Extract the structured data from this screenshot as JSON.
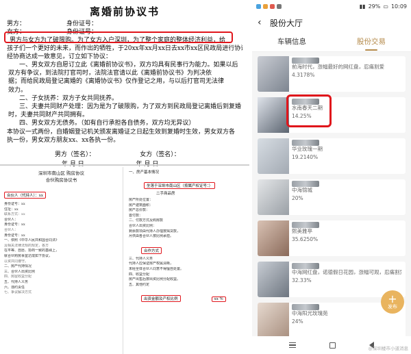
{
  "doc": {
    "title": "离婚前协议书",
    "male_label": "男方：",
    "id_label": "身份证号：",
    "female_label": "女方：",
    "intro_highlight": "男方与女方为了破限购。为了女方入户深圳，为了整个家庭的整体经济利益，",
    "intro_tail": "给",
    "intro_line2": "孩子们一个更好的未来，而作出的牺牲，于20xx年xx月xx日去xx市xx区民政局进行协议离婚，",
    "intro_line3": "经协商达成一致意见，订立如下协议：",
    "clauses": [
      "一、男女双方自愿订立此《离婚前协议书》，双方均具有民事行为能力。如果以后",
      "双方有争议，到法院打官司时，法院法官请以此《离婚前协议书》为判决依",
      "据；而给民政局登记离婚的《离婚协议书》仅作登记之用，与以后打官司无法律",
      "效力。",
      "二、子女抚养：双方子女共同抚养。",
      "三、夫妻共同财产处理：因为是为了破限购，为了双方到民政局登记离婚后到复婚",
      "时，夫妻共同财产共同拥有。",
      "四、男女双方无债务。（如有自行承担各自债务，双方均无异议）",
      "本协议一式两份，自婚姻登记机关颁发离婚证之日起生效到复婚时生效，男女双方各",
      "执一份，男女双方朋友xx、xx各执一份。"
    ],
    "sign_male": "男方（签名）：",
    "sign_female": "女方（签名）：",
    "date_text": "年    月    日"
  },
  "contract_a": {
    "header": "深圳市南山区    购房协议",
    "sub": "合伙购房协议书",
    "tag": "合伙人（代持人）：xx",
    "lines": [
      "身份证号：xx",
      "住址：xx",
      "联系方式：xx",
      "合伙人：",
      "身份证号：xx",
      "合伙人：",
      "身份证号：xx",
      "一、依照《中华人民共和国合同法》",
      "及相关法律法规的规定，各方",
      "在平等、自愿、协商一致的基础上，",
      "就合伙购房事宜达成如下协议，",
      "以资共同遵守。",
      "二、房产代持情况",
      "三、合伙人出资比例",
      "四、房屋收益分配",
      "五、代持人义务",
      "六、违约责任",
      "七、争议解决方式"
    ]
  },
  "contract_b": {
    "label_1": "一、房产基本情况",
    "tag_1": "坐落于深圳市南山区（按属产权证号：）",
    "tag_1b": "二手商品房",
    "tag_2": "合作方式",
    "tag_3": "出资金额及产权比例",
    "tag_4": "xx %",
    "lines": [
      "房产所处位置：",
      "房产建筑面积：",
      "房产总价款：",
      "首付款：",
      "二、付款方式及购房款",
      "合伙人出资比例：",
      "剩余款项由代持人办理按揭贷款，",
      "月供由各合伙人按比例承担。",
      "三、代持人义务",
      "代持人应保证房产权属清晰，",
      "未经全体合伙人同意不得擅自处置。",
      "四、收益分配",
      "房产出售后按出资比例分配收益。",
      "五、其他约定"
    ]
  },
  "phone": {
    "status_time": "10:09",
    "status_battery": "29%",
    "header_title": "股份大厅",
    "tabs": [
      "车辆信息",
      "股份交易"
    ],
    "active_tab": 1,
    "items": [
      {
        "name": "前海时代，涨幅最好的网红盘，忍痛割爱",
        "pct": "4.3178%"
      },
      {
        "name": "水南春天二期",
        "pct": "14.25%"
      },
      {
        "name": "华业玫瑰一期",
        "pct": "19.2140%"
      },
      {
        "name": "中海锦城",
        "pct": "20%"
      },
      {
        "name": "熙美雅亭",
        "pct": "35.6250%"
      },
      {
        "name": "中海网红盘，诺德假日花园，涨幅可观，忍痛割爱",
        "pct": "32.33%"
      },
      {
        "name": "中海阳光玫瑰苑",
        "pct": "24%"
      }
    ],
    "fab_label": "发布",
    "watermark": "@深圳楼市小道消息"
  },
  "colors": {
    "highlight_red": "#e0151b",
    "accent_gold": "#b48a4a",
    "fab": "#e9b45f"
  }
}
